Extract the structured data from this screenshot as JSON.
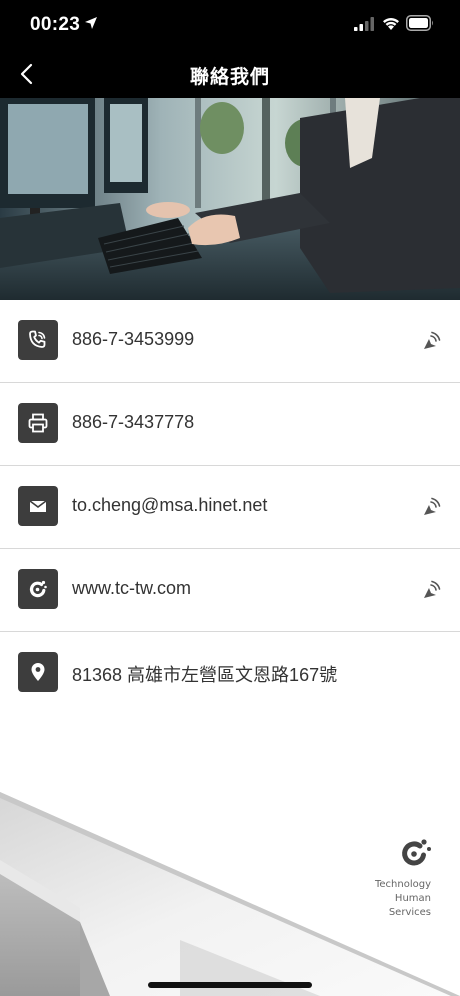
{
  "status_bar": {
    "time": "00:23",
    "location_icon": "location-arrow-icon",
    "signal_icon": "cellular-signal-icon",
    "wifi_icon": "wifi-icon",
    "battery_icon": "battery-icon"
  },
  "nav": {
    "title": "聯絡我們",
    "back_icon": "chevron-left-icon"
  },
  "hero": {
    "image": "office-keyboard-photo"
  },
  "contacts": [
    {
      "type": "phone",
      "icon": "phone-call-icon",
      "text": "886-7-3453999",
      "has_action": true,
      "action_icon": "tap-action-icon"
    },
    {
      "type": "fax",
      "icon": "printer-icon",
      "text": "886-7-3437778",
      "has_action": false
    },
    {
      "type": "email",
      "icon": "envelope-icon",
      "text": "to.cheng@msa.hinet.net",
      "has_action": true,
      "action_icon": "tap-action-icon"
    },
    {
      "type": "website",
      "icon": "brand-logo-icon",
      "text": "www.tc-tw.com",
      "has_action": true,
      "action_icon": "tap-action-icon"
    },
    {
      "type": "address",
      "icon": "map-pin-icon",
      "text": "81368 高雄市左營區文恩路167號",
      "has_action": false
    }
  ],
  "brand": {
    "line1": "Technology",
    "line2": "Human",
    "line3": "Services"
  },
  "colors": {
    "bar_background": "#000000",
    "icon_tile": "#3d3d3d",
    "divider": "#d8d8d8",
    "text": "#333333"
  }
}
